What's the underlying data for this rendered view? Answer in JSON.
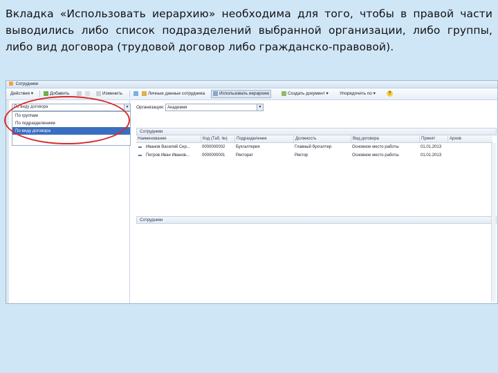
{
  "caption": "Вкладка «Использовать иерархию» необходима для того, чтобы в правой части выводились либо список подразделений выбранной организации, либо группы, либо вид договора (трудовой договор либо гражданско-правовой).",
  "window": {
    "title": "Сотрудники"
  },
  "toolbar": {
    "actions": "Действия ▾",
    "add": "Добавить",
    "edit": "Изменить",
    "personal_data": "Личные данные сотрудника",
    "use_hierarchy": "Использовать иерархию",
    "create_document": "Создать документ ▾",
    "sort_by": "Упорядочить по ▾",
    "help": "?"
  },
  "left_pane": {
    "combo_value": "По виду договора",
    "options": [
      "По группам",
      "По подразделениям",
      "По виду договора"
    ],
    "selected_index": 2
  },
  "right_pane": {
    "org_label": "Организация:",
    "org_value": "Академия",
    "group_top": "Сотрудники",
    "group_bottom": "Сотрудники",
    "columns": [
      "Наименование",
      "Код (Таб. №)",
      "Подразделение",
      "Должность",
      "Вид договора",
      "Принят",
      "Архив"
    ],
    "rows": [
      [
        "Иванов Василий Сер...",
        "0000000002",
        "Бухгалтерия",
        "Главный бухгалтер",
        "Основное место работы",
        "01.01.2013",
        ""
      ],
      [
        "Петров Иван Иванов...",
        "0000000001",
        "Ректорат",
        "Ректор",
        "Основное место работы",
        "01.01.2013",
        ""
      ]
    ]
  },
  "colors": {
    "highlight": "#d82a2a",
    "selection": "#3a6ec0",
    "background": "#cfe6f7"
  }
}
